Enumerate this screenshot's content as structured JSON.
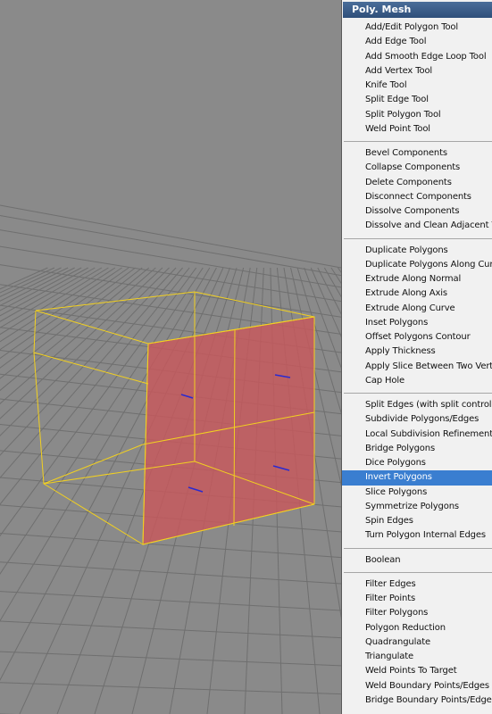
{
  "menu": {
    "title": "Poly. Mesh",
    "groups": [
      [
        "Add/Edit Polygon Tool",
        "Add Edge Tool",
        "Add Smooth Edge Loop Tool",
        "Add Vertex Tool",
        "Knife Tool",
        "Split Edge Tool",
        "Split Polygon Tool",
        "Weld Point Tool"
      ],
      [
        "Bevel Components",
        "Collapse Components",
        "Delete Components",
        "Disconnect Components",
        "Dissolve Components",
        "Dissolve and Clean Adjacent Ve"
      ],
      [
        "Duplicate Polygons",
        "Duplicate Polygons Along Curve",
        "Extrude Along Normal",
        "Extrude Along Axis",
        "Extrude Along Curve",
        "Inset Polygons",
        "Offset Polygons Contour",
        "Apply Thickness",
        "Apply Slice Between Two Vertic",
        "Cap Hole"
      ],
      [
        "Split Edges (with split control)",
        "Subdivide Polygons/Edges",
        "Local Subdivision Refinement",
        "Bridge Polygons",
        "Dice Polygons",
        "Invert Polygons",
        "Slice Polygons",
        "Symmetrize Polygons",
        "Spin Edges",
        "Turn Polygon Internal Edges"
      ],
      [
        "Boolean"
      ],
      [
        "Filter Edges",
        "Filter Points",
        "Filter Polygons",
        "Polygon Reduction",
        "Quadrangulate",
        "Triangulate",
        "Weld Points To Target",
        "Weld Boundary Points/Edges",
        "Bridge Boundary Points/Edges"
      ]
    ],
    "highlighted_item": "Invert Polygons",
    "highlight_color": "#3a7ed0"
  },
  "viewport": {
    "background_color": "#8a8a8a",
    "grid_color": "#6f6f6f",
    "wireframe_color": "#f2d020",
    "selected_polygon_color": "#c8585c",
    "normal_marker_color": "#2a2ad0"
  }
}
